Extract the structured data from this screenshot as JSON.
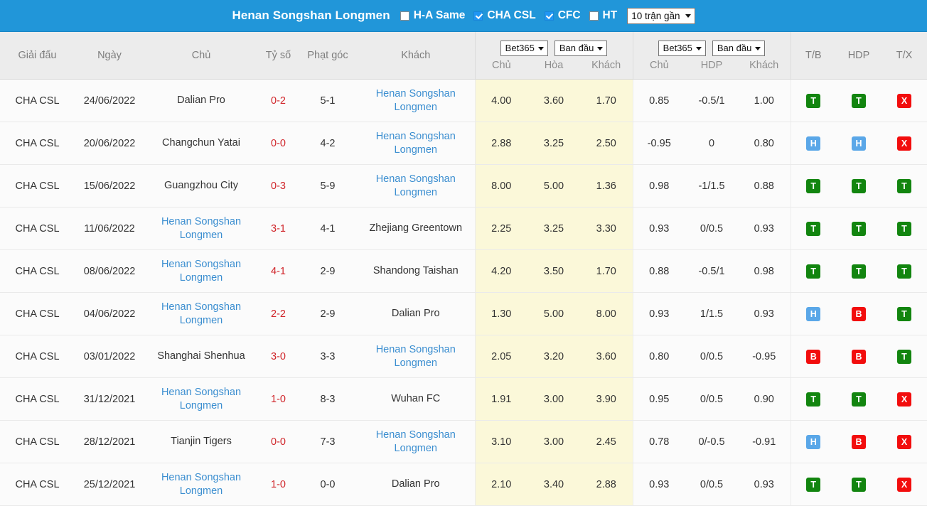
{
  "topbar": {
    "team_title": "Henan Songshan Longmen",
    "checkboxes": [
      {
        "label": "H-A Same",
        "checked": false
      },
      {
        "label": "CHA CSL",
        "checked": true
      },
      {
        "label": "CFC",
        "checked": true
      },
      {
        "label": "HT",
        "checked": false
      }
    ],
    "range_select": "10 trận gần",
    "bg_color": "#2196d9"
  },
  "table": {
    "headers": {
      "league": "Giải đấu",
      "date": "Ngày",
      "home": "Chủ",
      "score": "Tỷ số",
      "corners": "Phạt góc",
      "away": "Khách",
      "tb": "T/B",
      "hdp": "HDP",
      "tx": "T/X"
    },
    "odds_group_1": {
      "bookmaker": "Bet365",
      "phase": "Ban đầu",
      "sub": [
        "Chủ",
        "Hòa",
        "Khách"
      ]
    },
    "odds_group_2": {
      "bookmaker": "Bet365",
      "phase": "Ban đầu",
      "sub": [
        "Chủ",
        "HDP",
        "Khách"
      ]
    },
    "rows": [
      {
        "league": "CHA CSL",
        "date": "24/06/2022",
        "home": "Dalian Pro",
        "home_link": false,
        "score": "0-2",
        "corners": "5-1",
        "away": "Henan Songshan Longmen",
        "away_link": true,
        "o1": "4.00",
        "o2": "3.60",
        "o3": "1.70",
        "a1": "0.85",
        "a2": "-0.5/1",
        "a3": "1.00",
        "tb": "T",
        "hdp": "T",
        "tx": "X"
      },
      {
        "league": "CHA CSL",
        "date": "20/06/2022",
        "home": "Changchun Yatai",
        "home_link": false,
        "score": "0-0",
        "corners": "4-2",
        "away": "Henan Songshan Longmen",
        "away_link": true,
        "o1": "2.88",
        "o2": "3.25",
        "o3": "2.50",
        "a1": "-0.95",
        "a2": "0",
        "a3": "0.80",
        "tb": "H",
        "hdp": "H",
        "tx": "X"
      },
      {
        "league": "CHA CSL",
        "date": "15/06/2022",
        "home": "Guangzhou City",
        "home_link": false,
        "score": "0-3",
        "corners": "5-9",
        "away": "Henan Songshan Longmen",
        "away_link": true,
        "o1": "8.00",
        "o2": "5.00",
        "o3": "1.36",
        "a1": "0.98",
        "a2": "-1/1.5",
        "a3": "0.88",
        "tb": "T",
        "hdp": "T",
        "tx": "T"
      },
      {
        "league": "CHA CSL",
        "date": "11/06/2022",
        "home": "Henan Songshan Longmen",
        "home_link": true,
        "score": "3-1",
        "corners": "4-1",
        "away": "Zhejiang Greentown",
        "away_link": false,
        "o1": "2.25",
        "o2": "3.25",
        "o3": "3.30",
        "a1": "0.93",
        "a2": "0/0.5",
        "a3": "0.93",
        "tb": "T",
        "hdp": "T",
        "tx": "T"
      },
      {
        "league": "CHA CSL",
        "date": "08/06/2022",
        "home": "Henan Songshan Longmen",
        "home_link": true,
        "score": "4-1",
        "corners": "2-9",
        "away": "Shandong Taishan",
        "away_link": false,
        "o1": "4.20",
        "o2": "3.50",
        "o3": "1.70",
        "a1": "0.88",
        "a2": "-0.5/1",
        "a3": "0.98",
        "tb": "T",
        "hdp": "T",
        "tx": "T"
      },
      {
        "league": "CHA CSL",
        "date": "04/06/2022",
        "home": "Henan Songshan Longmen",
        "home_link": true,
        "score": "2-2",
        "corners": "2-9",
        "away": "Dalian Pro",
        "away_link": false,
        "o1": "1.30",
        "o2": "5.00",
        "o3": "8.00",
        "a1": "0.93",
        "a2": "1/1.5",
        "a3": "0.93",
        "tb": "H",
        "hdp": "B",
        "tx": "T"
      },
      {
        "league": "CHA CSL",
        "date": "03/01/2022",
        "home": "Shanghai Shenhua",
        "home_link": false,
        "score": "3-0",
        "corners": "3-3",
        "away": "Henan Songshan Longmen",
        "away_link": true,
        "o1": "2.05",
        "o2": "3.20",
        "o3": "3.60",
        "a1": "0.80",
        "a2": "0/0.5",
        "a3": "-0.95",
        "tb": "B",
        "hdp": "B",
        "tx": "T"
      },
      {
        "league": "CHA CSL",
        "date": "31/12/2021",
        "home": "Henan Songshan Longmen",
        "home_link": true,
        "score": "1-0",
        "corners": "8-3",
        "away": "Wuhan FC",
        "away_link": false,
        "o1": "1.91",
        "o2": "3.00",
        "o3": "3.90",
        "a1": "0.95",
        "a2": "0/0.5",
        "a3": "0.90",
        "tb": "T",
        "hdp": "T",
        "tx": "X"
      },
      {
        "league": "CHA CSL",
        "date": "28/12/2021",
        "home": "Tianjin Tigers",
        "home_link": false,
        "score": "0-0",
        "corners": "7-3",
        "away": "Henan Songshan Longmen",
        "away_link": true,
        "o1": "3.10",
        "o2": "3.00",
        "o3": "2.45",
        "a1": "0.78",
        "a2": "0/-0.5",
        "a3": "-0.91",
        "tb": "H",
        "hdp": "B",
        "tx": "X"
      },
      {
        "league": "CHA CSL",
        "date": "25/12/2021",
        "home": "Henan Songshan Longmen",
        "home_link": true,
        "score": "1-0",
        "corners": "0-0",
        "away": "Dalian Pro",
        "away_link": false,
        "o1": "2.10",
        "o2": "3.40",
        "o3": "2.88",
        "a1": "0.93",
        "a2": "0/0.5",
        "a3": "0.93",
        "tb": "T",
        "hdp": "T",
        "tx": "X"
      }
    ]
  },
  "colors": {
    "header_blue": "#2196d9",
    "link_blue": "#3b8ed0",
    "score_red": "#d0252a",
    "odds_yellow": "#fbf8d9",
    "badge_green": "#12850f",
    "badge_blue": "#5aa7e8",
    "badge_red": "#f20d0d"
  }
}
